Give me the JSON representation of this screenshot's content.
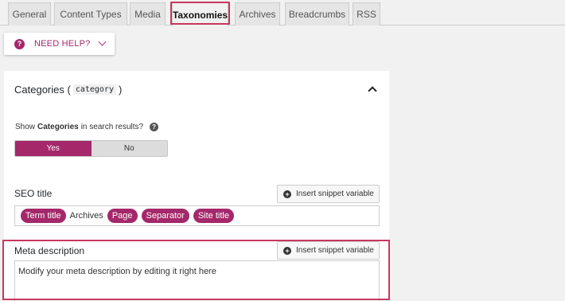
{
  "tabs": [
    {
      "label": "General"
    },
    {
      "label": "Content Types"
    },
    {
      "label": "Media"
    },
    {
      "label": "Taxonomies",
      "active": true
    },
    {
      "label": "Archives"
    },
    {
      "label": "Breadcrumbs"
    },
    {
      "label": "RSS"
    }
  ],
  "help": {
    "label": "NEED HELP?",
    "icon": "question-icon"
  },
  "panel": {
    "title": "Categories (",
    "code": "category",
    "title_close": ")",
    "show_label_prefix": "Show",
    "show_label_bold": "Categories",
    "show_label_suffix": "in search results?",
    "toggle": {
      "yes": "Yes",
      "no": "No",
      "selected": "Yes"
    },
    "seo_title": {
      "label": "SEO title",
      "snippet_button": "Insert snippet variable",
      "parts": [
        "Term title",
        "Archives",
        "Page",
        "Separator",
        "Site title"
      ]
    },
    "meta_description": {
      "label": "Meta description",
      "snippet_button": "Insert snippet variable",
      "placeholder": "Modify your meta description by editing it right here"
    }
  },
  "colors": {
    "accent": "#a4286a",
    "highlight": "#c8375f"
  }
}
